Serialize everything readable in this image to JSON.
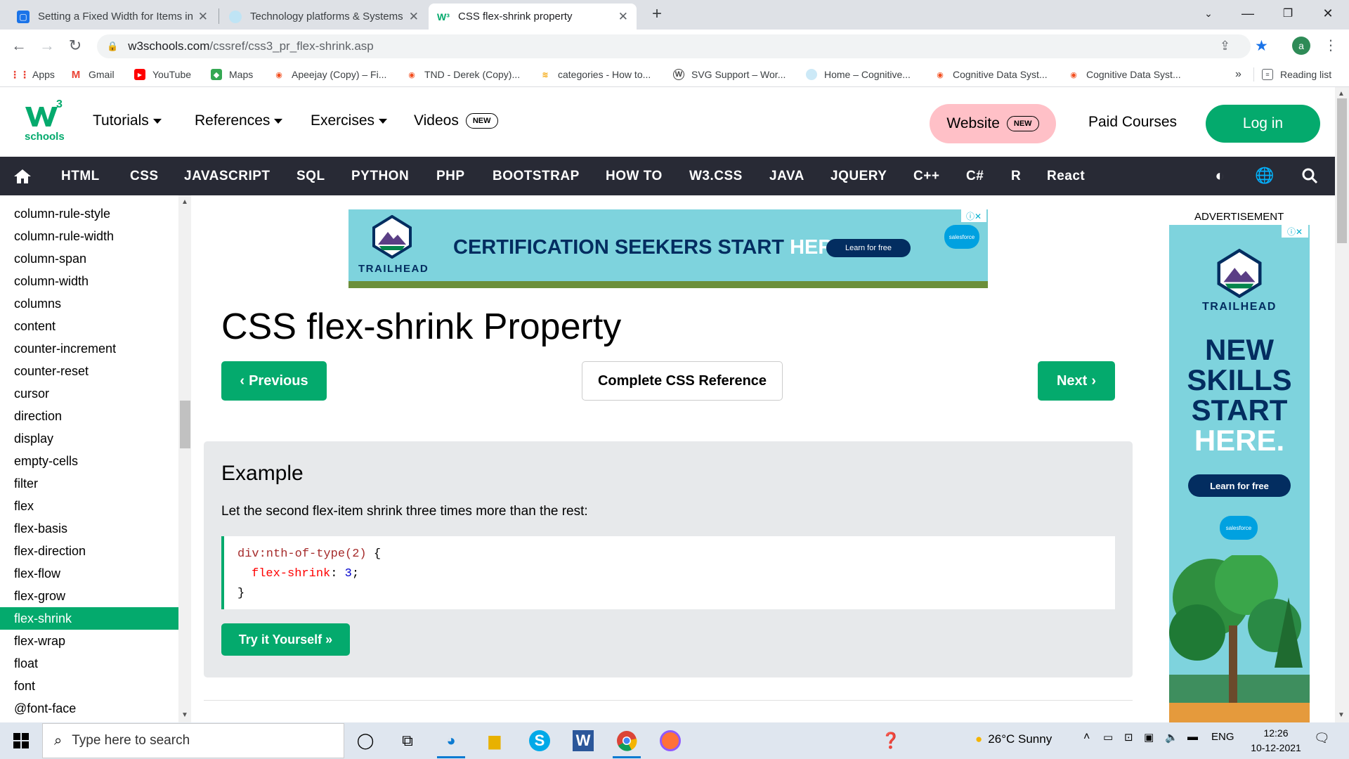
{
  "browser": {
    "tabs": [
      {
        "title": "Setting a Fixed Width for Items in",
        "icon": "document-icon"
      },
      {
        "title": "Technology platforms & Systems",
        "icon": "globe-icon"
      },
      {
        "title": "CSS flex-shrink property",
        "icon": "w3schools-icon"
      }
    ],
    "new_tab": "+",
    "address": {
      "host": "w3schools.com",
      "path": "/cssref/css3_pr_flex-shrink.asp"
    },
    "profile_initial": "a",
    "bookmarks": [
      "Apps",
      "Gmail",
      "YouTube",
      "Maps",
      "Apeejay (Copy) – Fi...",
      "TND - Derek (Copy)...",
      "categories - How to...",
      "SVG Support – Wor...",
      "Home – Cognitive...",
      "Cognitive Data Syst...",
      "Cognitive Data Syst..."
    ],
    "bookmarks_overflow": "»",
    "reading_list": "Reading list"
  },
  "site": {
    "logo_text": "schools",
    "logo_sup": "3",
    "menu": [
      "Tutorials",
      "References",
      "Exercises",
      "Videos"
    ],
    "new_badge": "NEW",
    "website_label": "Website",
    "paid_courses": "Paid Courses",
    "login": "Log in",
    "nav": [
      "HTML",
      "CSS",
      "JAVASCRIPT",
      "SQL",
      "PYTHON",
      "PHP",
      "BOOTSTRAP",
      "HOW TO",
      "W3.CSS",
      "JAVA",
      "JQUERY",
      "C++",
      "C#",
      "R",
      "React"
    ]
  },
  "sidebar": {
    "items": [
      "column-rule-style",
      "column-rule-width",
      "column-span",
      "column-width",
      "columns",
      "content",
      "counter-increment",
      "counter-reset",
      "cursor",
      "direction",
      "display",
      "empty-cells",
      "filter",
      "flex",
      "flex-basis",
      "flex-direction",
      "flex-flow",
      "flex-grow",
      "flex-shrink",
      "flex-wrap",
      "float",
      "font",
      "@font-face",
      "font-family"
    ],
    "active": "flex-shrink"
  },
  "ad_banner": {
    "brand": "TRAILHEAD",
    "headline_a": "CERTIFICATION SEEKERS START ",
    "headline_b": "HERE.",
    "cta": "Learn for free",
    "sponsor": "salesforce"
  },
  "main": {
    "title": "CSS flex-shrink Property",
    "prev": "Previous",
    "reference": "Complete CSS Reference",
    "next": "Next",
    "example_title": "Example",
    "example_desc": "Let the second flex-item shrink three times more than the rest:",
    "code": {
      "selector": "div:nth-of-type(2)",
      "open": " {",
      "property": "flex-shrink",
      "colon": ": ",
      "value": "3",
      "semicolon": ";",
      "close": "}"
    },
    "try_button": "Try it Yourself »"
  },
  "side_ad": {
    "label": "ADVERTISEMENT",
    "brand": "TRAILHEAD",
    "lines": [
      "NEW",
      "SKILLS",
      "START",
      "HERE."
    ],
    "cta": "Learn for free",
    "sponsor": "salesforce"
  },
  "taskbar": {
    "search_placeholder": "Type here to search",
    "weather": "26°C  Sunny",
    "language": "ENG",
    "time": "12:26",
    "date": "10-12-2021"
  },
  "colors": {
    "brand_green": "#04aa6d",
    "nav_dark": "#282a35",
    "website_pink": "#ffc0c7",
    "ad_teal": "#7ed3dd"
  }
}
